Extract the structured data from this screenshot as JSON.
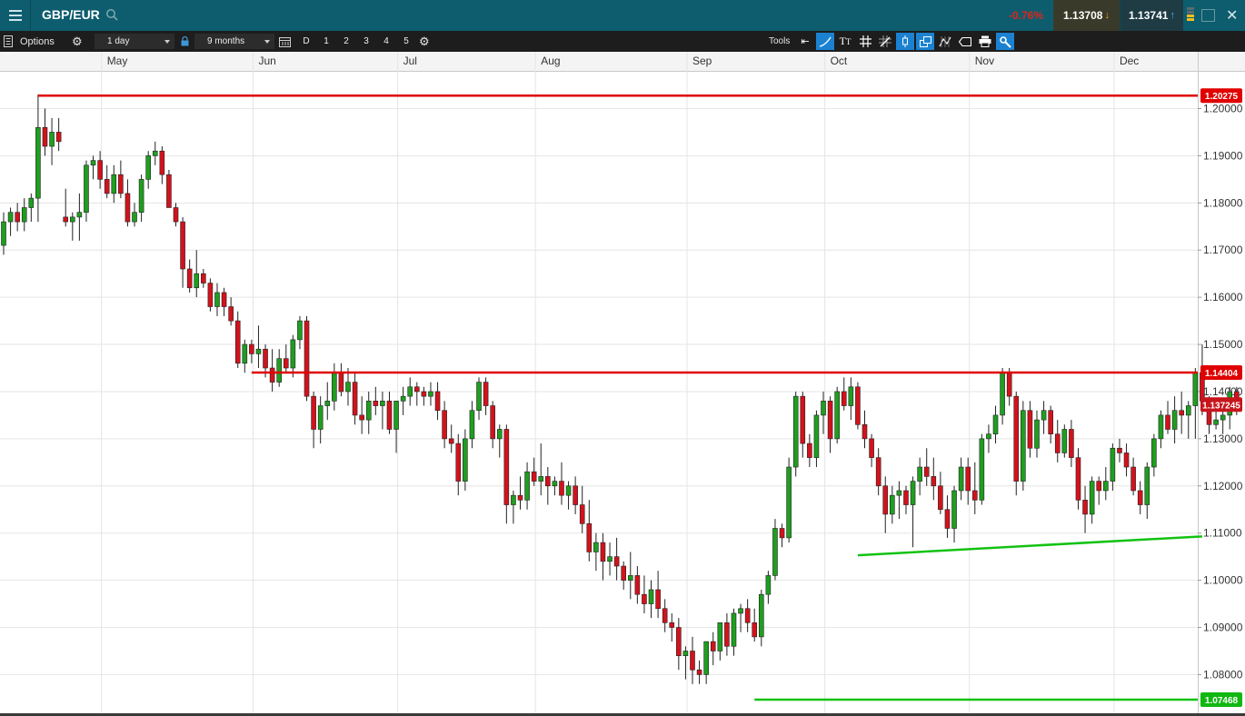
{
  "header": {
    "instrument": "GBP/EUR",
    "change_pct": "-0.76%",
    "sell_price": "1.13708",
    "buy_price": "1.13741"
  },
  "toolbar": {
    "options_label": "Options",
    "interval": "1 day",
    "range": "9 months",
    "d_label": "D",
    "presets": [
      "1",
      "2",
      "3",
      "4",
      "5"
    ],
    "tools_label": "Tools"
  },
  "colors": {
    "up": "#1f9e1f",
    "down": "#d3121c",
    "resistance": "#e00000",
    "support": "#12c212",
    "topbar": "#0d5d6e",
    "toolbar": "#1d1d1d"
  },
  "chart_data": {
    "type": "candlestick",
    "months": [
      "May",
      "Jun",
      "Jul",
      "Aug",
      "Sep",
      "Oct",
      "Nov",
      "Dec"
    ],
    "y_ticks": [
      "1.20000",
      "1.19000",
      "1.18000",
      "1.17000",
      "1.16000",
      "1.15000",
      "1.14000",
      "1.13000",
      "1.12000",
      "1.11000",
      "1.10000",
      "1.09000",
      "1.08000"
    ],
    "ylim": [
      1.0718,
      1.2078
    ],
    "grid": true,
    "price_labels": [
      {
        "value": 1.20275,
        "text": "1.20275",
        "color": "#e00000"
      },
      {
        "value": 1.14404,
        "text": "1.14404",
        "color": "#e00000"
      },
      {
        "value": 1.137245,
        "text": "1.137245",
        "color": "#c7151c"
      },
      {
        "value": 1.07468,
        "text": "1.07468",
        "color": "#12b812"
      }
    ],
    "horizontal_lines": [
      {
        "start_index": 5,
        "value": 1.20275,
        "color": "#e00000"
      },
      {
        "start_index": 36,
        "value": 1.14404,
        "color": "#e00000"
      },
      {
        "start_index": 109,
        "value": 1.07468,
        "color": "#12c212"
      }
    ],
    "trendlines": [
      {
        "index1": 124,
        "value1": 1.1053,
        "index2": 174,
        "value2": 1.1093,
        "extend": true,
        "color": "#12c212"
      }
    ],
    "candles": [
      [
        1.171,
        1.178,
        1.169,
        1.176
      ],
      [
        1.176,
        1.179,
        1.173,
        1.178
      ],
      [
        1.178,
        1.18,
        1.174,
        1.176
      ],
      [
        1.176,
        1.181,
        1.174,
        1.179
      ],
      [
        1.179,
        1.182,
        1.176,
        1.181
      ],
      [
        1.181,
        1.203,
        1.176,
        1.196
      ],
      [
        1.196,
        1.2,
        1.19,
        1.192
      ],
      [
        1.192,
        1.198,
        1.188,
        1.195
      ],
      [
        1.195,
        1.198,
        1.191,
        1.193
      ],
      [
        1.177,
        1.183,
        1.175,
        1.176
      ],
      [
        1.176,
        1.178,
        1.172,
        1.177
      ],
      [
        1.177,
        1.182,
        1.172,
        1.178
      ],
      [
        1.178,
        1.189,
        1.176,
        1.188
      ],
      [
        1.188,
        1.19,
        1.185,
        1.189
      ],
      [
        1.189,
        1.191,
        1.183,
        1.185
      ],
      [
        1.185,
        1.188,
        1.181,
        1.182
      ],
      [
        1.182,
        1.188,
        1.18,
        1.186
      ],
      [
        1.186,
        1.189,
        1.181,
        1.182
      ],
      [
        1.182,
        1.185,
        1.175,
        1.176
      ],
      [
        1.176,
        1.18,
        1.175,
        1.178
      ],
      [
        1.178,
        1.186,
        1.176,
        1.185
      ],
      [
        1.185,
        1.191,
        1.183,
        1.19
      ],
      [
        1.19,
        1.193,
        1.188,
        1.191
      ],
      [
        1.191,
        1.192,
        1.184,
        1.186
      ],
      [
        1.186,
        1.187,
        1.179,
        1.179
      ],
      [
        1.179,
        1.18,
        1.175,
        1.176
      ],
      [
        1.176,
        1.177,
        1.162,
        1.166
      ],
      [
        1.166,
        1.168,
        1.161,
        1.162
      ],
      [
        1.162,
        1.17,
        1.16,
        1.165
      ],
      [
        1.165,
        1.166,
        1.162,
        1.163
      ],
      [
        1.163,
        1.164,
        1.157,
        1.158
      ],
      [
        1.158,
        1.163,
        1.156,
        1.161
      ],
      [
        1.161,
        1.162,
        1.156,
        1.158
      ],
      [
        1.158,
        1.16,
        1.154,
        1.155
      ],
      [
        1.155,
        1.157,
        1.145,
        1.146
      ],
      [
        1.146,
        1.151,
        1.144,
        1.15
      ],
      [
        1.15,
        1.151,
        1.146,
        1.148
      ],
      [
        1.148,
        1.154,
        1.145,
        1.149
      ],
      [
        1.149,
        1.15,
        1.143,
        1.145
      ],
      [
        1.145,
        1.149,
        1.14,
        1.142
      ],
      [
        1.142,
        1.149,
        1.141,
        1.147
      ],
      [
        1.147,
        1.15,
        1.144,
        1.145
      ],
      [
        1.145,
        1.152,
        1.143,
        1.151
      ],
      [
        1.151,
        1.156,
        1.149,
        1.155
      ],
      [
        1.155,
        1.156,
        1.138,
        1.139
      ],
      [
        1.139,
        1.14,
        1.128,
        1.132
      ],
      [
        1.132,
        1.139,
        1.129,
        1.137
      ],
      [
        1.137,
        1.142,
        1.134,
        1.138
      ],
      [
        1.138,
        1.146,
        1.136,
        1.144
      ],
      [
        1.144,
        1.146,
        1.139,
        1.14
      ],
      [
        1.14,
        1.145,
        1.137,
        1.142
      ],
      [
        1.142,
        1.144,
        1.133,
        1.135
      ],
      [
        1.135,
        1.139,
        1.131,
        1.134
      ],
      [
        1.134,
        1.14,
        1.131,
        1.138
      ],
      [
        1.138,
        1.141,
        1.135,
        1.137
      ],
      [
        1.137,
        1.14,
        1.132,
        1.138
      ],
      [
        1.138,
        1.14,
        1.131,
        1.132
      ],
      [
        1.132,
        1.138,
        1.127,
        1.138
      ],
      [
        1.138,
        1.141,
        1.135,
        1.139
      ],
      [
        1.139,
        1.143,
        1.137,
        1.141
      ],
      [
        1.141,
        1.142,
        1.137,
        1.14
      ],
      [
        1.14,
        1.141,
        1.137,
        1.139
      ],
      [
        1.139,
        1.142,
        1.137,
        1.14
      ],
      [
        1.14,
        1.142,
        1.134,
        1.136
      ],
      [
        1.136,
        1.138,
        1.128,
        1.13
      ],
      [
        1.13,
        1.133,
        1.127,
        1.129
      ],
      [
        1.129,
        1.131,
        1.118,
        1.121
      ],
      [
        1.121,
        1.132,
        1.119,
        1.13
      ],
      [
        1.13,
        1.138,
        1.128,
        1.136
      ],
      [
        1.136,
        1.143,
        1.134,
        1.142
      ],
      [
        1.142,
        1.143,
        1.135,
        1.137
      ],
      [
        1.137,
        1.138,
        1.128,
        1.13
      ],
      [
        1.13,
        1.133,
        1.126,
        1.132
      ],
      [
        1.132,
        1.133,
        1.112,
        1.116
      ],
      [
        1.116,
        1.119,
        1.112,
        1.118
      ],
      [
        1.118,
        1.122,
        1.115,
        1.117
      ],
      [
        1.117,
        1.125,
        1.115,
        1.123
      ],
      [
        1.123,
        1.126,
        1.12,
        1.121
      ],
      [
        1.121,
        1.129,
        1.118,
        1.122
      ],
      [
        1.122,
        1.124,
        1.116,
        1.12
      ],
      [
        1.12,
        1.122,
        1.118,
        1.121
      ],
      [
        1.121,
        1.125,
        1.116,
        1.118
      ],
      [
        1.118,
        1.121,
        1.115,
        1.12
      ],
      [
        1.12,
        1.122,
        1.114,
        1.116
      ],
      [
        1.116,
        1.12,
        1.11,
        1.112
      ],
      [
        1.112,
        1.117,
        1.104,
        1.106
      ],
      [
        1.106,
        1.11,
        1.102,
        1.108
      ],
      [
        1.108,
        1.11,
        1.1,
        1.104
      ],
      [
        1.104,
        1.108,
        1.101,
        1.105
      ],
      [
        1.105,
        1.109,
        1.1,
        1.103
      ],
      [
        1.103,
        1.104,
        1.098,
        1.1
      ],
      [
        1.1,
        1.106,
        1.096,
        1.101
      ],
      [
        1.101,
        1.103,
        1.095,
        1.097
      ],
      [
        1.097,
        1.101,
        1.093,
        1.095
      ],
      [
        1.095,
        1.1,
        1.092,
        1.098
      ],
      [
        1.098,
        1.102,
        1.092,
        1.094
      ],
      [
        1.094,
        1.096,
        1.089,
        1.091
      ],
      [
        1.091,
        1.093,
        1.087,
        1.09
      ],
      [
        1.09,
        1.092,
        1.081,
        1.084
      ],
      [
        1.084,
        1.086,
        1.079,
        1.085
      ],
      [
        1.085,
        1.088,
        1.078,
        1.081
      ],
      [
        1.081,
        1.083,
        1.078,
        1.08
      ],
      [
        1.08,
        1.087,
        1.078,
        1.087
      ],
      [
        1.087,
        1.089,
        1.082,
        1.085
      ],
      [
        1.085,
        1.091,
        1.083,
        1.091
      ],
      [
        1.091,
        1.093,
        1.084,
        1.086
      ],
      [
        1.086,
        1.094,
        1.084,
        1.093
      ],
      [
        1.093,
        1.095,
        1.089,
        1.094
      ],
      [
        1.094,
        1.096,
        1.089,
        1.091
      ],
      [
        1.091,
        1.094,
        1.087,
        1.088
      ],
      [
        1.088,
        1.098,
        1.086,
        1.097
      ],
      [
        1.097,
        1.102,
        1.095,
        1.101
      ],
      [
        1.101,
        1.113,
        1.1,
        1.111
      ],
      [
        1.111,
        1.112,
        1.107,
        1.109
      ],
      [
        1.109,
        1.126,
        1.108,
        1.124
      ],
      [
        1.124,
        1.14,
        1.122,
        1.139
      ],
      [
        1.139,
        1.14,
        1.126,
        1.129
      ],
      [
        1.129,
        1.131,
        1.124,
        1.126
      ],
      [
        1.126,
        1.136,
        1.124,
        1.135
      ],
      [
        1.135,
        1.14,
        1.131,
        1.138
      ],
      [
        1.138,
        1.139,
        1.127,
        1.13
      ],
      [
        1.13,
        1.141,
        1.129,
        1.14
      ],
      [
        1.14,
        1.143,
        1.136,
        1.137
      ],
      [
        1.137,
        1.143,
        1.134,
        1.141
      ],
      [
        1.141,
        1.142,
        1.132,
        1.133
      ],
      [
        1.133,
        1.136,
        1.128,
        1.13
      ],
      [
        1.13,
        1.131,
        1.124,
        1.126
      ],
      [
        1.126,
        1.128,
        1.118,
        1.12
      ],
      [
        1.12,
        1.122,
        1.11,
        1.114
      ],
      [
        1.114,
        1.12,
        1.112,
        1.118
      ],
      [
        1.118,
        1.121,
        1.113,
        1.119
      ],
      [
        1.119,
        1.12,
        1.114,
        1.116
      ],
      [
        1.116,
        1.122,
        1.107,
        1.121
      ],
      [
        1.121,
        1.126,
        1.118,
        1.124
      ],
      [
        1.124,
        1.128,
        1.12,
        1.122
      ],
      [
        1.122,
        1.126,
        1.117,
        1.12
      ],
      [
        1.12,
        1.123,
        1.114,
        1.115
      ],
      [
        1.115,
        1.118,
        1.109,
        1.111
      ],
      [
        1.111,
        1.12,
        1.108,
        1.119
      ],
      [
        1.119,
        1.126,
        1.117,
        1.124
      ],
      [
        1.124,
        1.126,
        1.116,
        1.119
      ],
      [
        1.119,
        1.125,
        1.114,
        1.117
      ],
      [
        1.117,
        1.131,
        1.116,
        1.13
      ],
      [
        1.13,
        1.133,
        1.127,
        1.131
      ],
      [
        1.131,
        1.137,
        1.129,
        1.135
      ],
      [
        1.135,
        1.145,
        1.133,
        1.144
      ],
      [
        1.144,
        1.145,
        1.137,
        1.139
      ],
      [
        1.139,
        1.14,
        1.118,
        1.121
      ],
      [
        1.121,
        1.138,
        1.119,
        1.136
      ],
      [
        1.136,
        1.138,
        1.126,
        1.128
      ],
      [
        1.128,
        1.136,
        1.126,
        1.134
      ],
      [
        1.134,
        1.138,
        1.131,
        1.136
      ],
      [
        1.136,
        1.137,
        1.129,
        1.131
      ],
      [
        1.131,
        1.134,
        1.125,
        1.127
      ],
      [
        1.127,
        1.133,
        1.126,
        1.132
      ],
      [
        1.132,
        1.134,
        1.124,
        1.126
      ],
      [
        1.126,
        1.128,
        1.115,
        1.117
      ],
      [
        1.117,
        1.12,
        1.11,
        1.114
      ],
      [
        1.114,
        1.122,
        1.112,
        1.121
      ],
      [
        1.121,
        1.122,
        1.116,
        1.119
      ],
      [
        1.119,
        1.124,
        1.117,
        1.121
      ],
      [
        1.121,
        1.129,
        1.119,
        1.128
      ],
      [
        1.128,
        1.13,
        1.125,
        1.127
      ],
      [
        1.127,
        1.129,
        1.122,
        1.124
      ],
      [
        1.124,
        1.126,
        1.118,
        1.119
      ],
      [
        1.119,
        1.121,
        1.114,
        1.116
      ],
      [
        1.116,
        1.125,
        1.113,
        1.124
      ],
      [
        1.124,
        1.131,
        1.122,
        1.13
      ],
      [
        1.13,
        1.136,
        1.128,
        1.135
      ],
      [
        1.135,
        1.138,
        1.131,
        1.132
      ],
      [
        1.132,
        1.139,
        1.129,
        1.136
      ],
      [
        1.136,
        1.14,
        1.131,
        1.135
      ],
      [
        1.135,
        1.138,
        1.13,
        1.137
      ],
      [
        1.137,
        1.145,
        1.13,
        1.144
      ],
      [
        1.144,
        1.15,
        1.135,
        1.138
      ],
      [
        1.138,
        1.139,
        1.131,
        1.133
      ],
      [
        1.133,
        1.137,
        1.132,
        1.134
      ],
      [
        1.134,
        1.137,
        1.131,
        1.135
      ],
      [
        1.135,
        1.141,
        1.132,
        1.14
      ],
      [
        1.14,
        1.141,
        1.135,
        1.137
      ]
    ]
  }
}
